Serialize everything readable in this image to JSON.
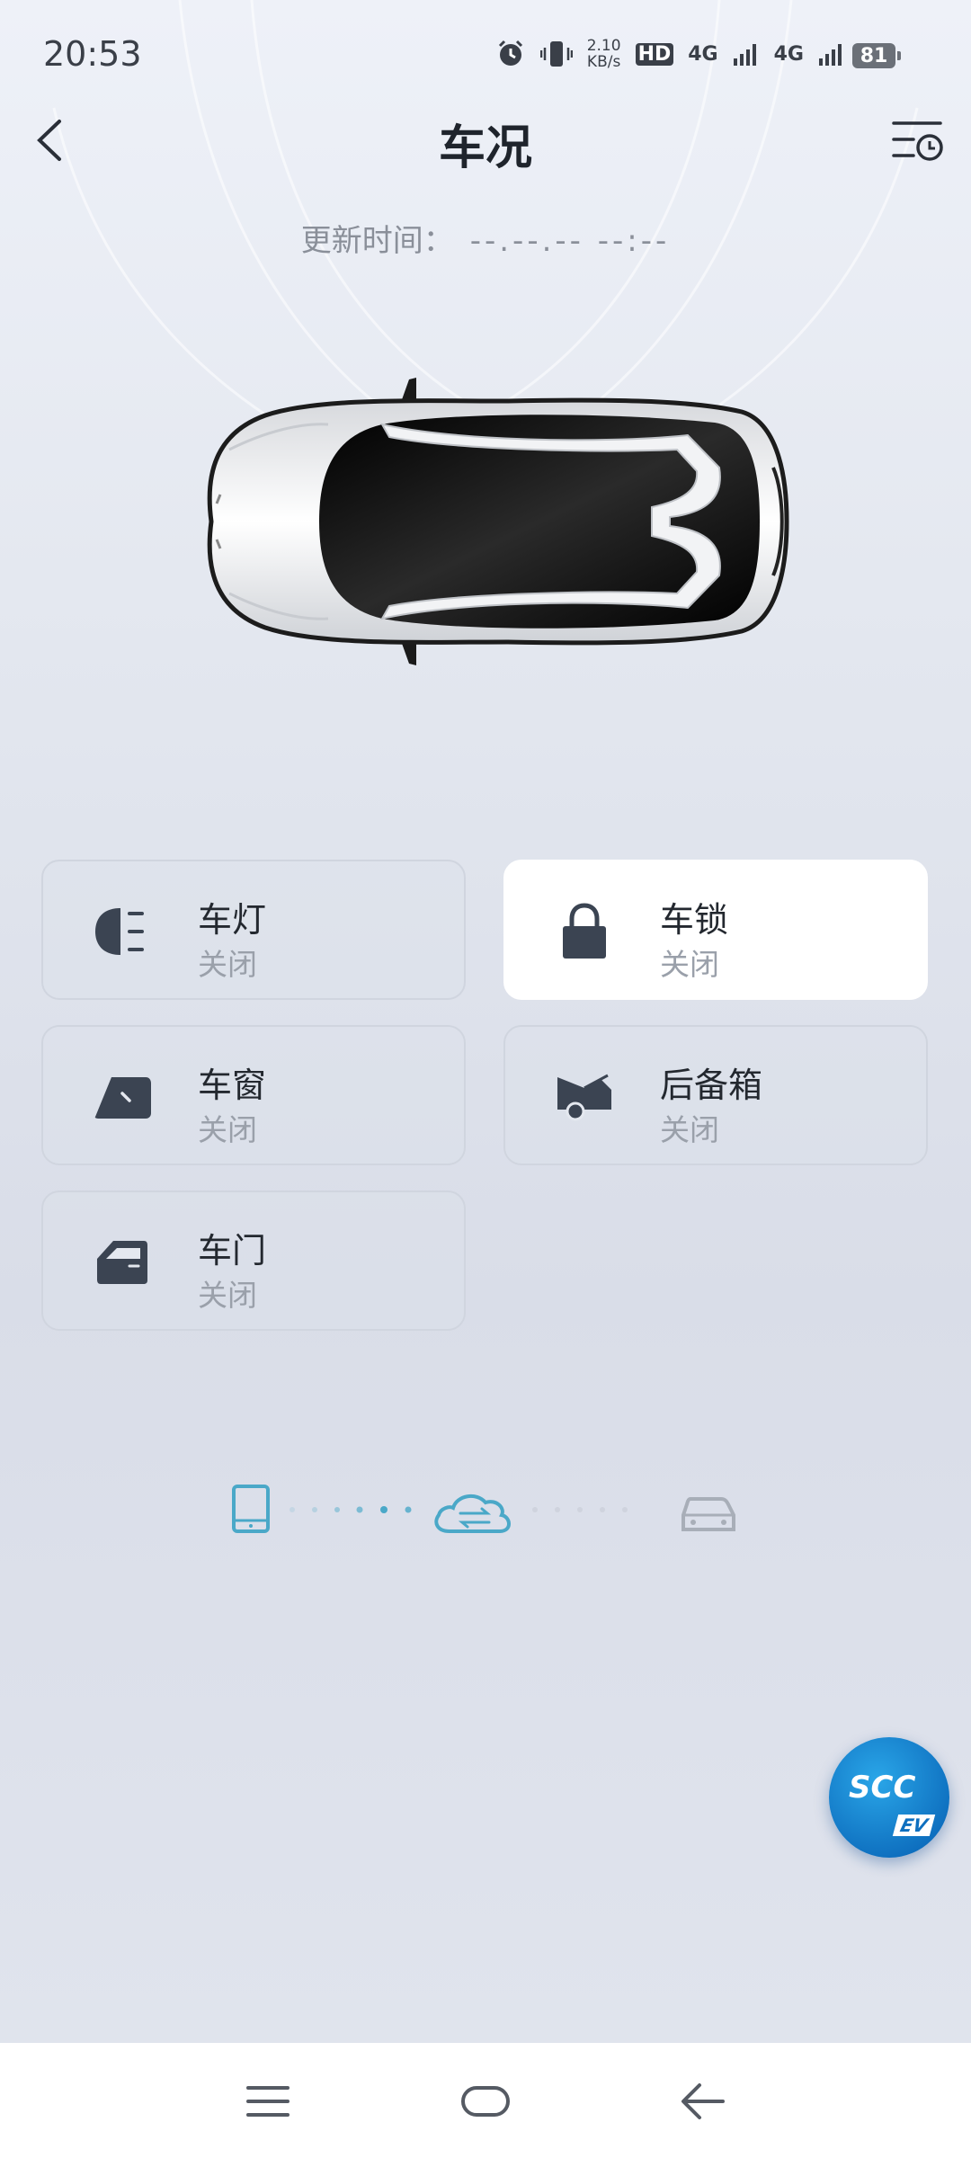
{
  "status_bar": {
    "time": "20:53",
    "speed_value": "2.10",
    "speed_unit": "KB/s",
    "hd_label": "HD",
    "network1": "4G",
    "network2": "4G",
    "battery": "81",
    "icons": [
      "alarm-icon",
      "vibrate-icon",
      "signal-icon",
      "signal-icon"
    ]
  },
  "header": {
    "title": "车况",
    "back_icon": "chevron-left-icon",
    "history_icon": "list-clock-icon"
  },
  "update": {
    "label": "更新时间：",
    "value": "--.--.-- --:--"
  },
  "tiles": [
    {
      "name": "车灯",
      "state": "关闭",
      "icon": "headlight-icon",
      "active": false
    },
    {
      "name": "车锁",
      "state": "关闭",
      "icon": "lock-icon",
      "active": true
    },
    {
      "name": "车窗",
      "state": "关闭",
      "icon": "window-icon",
      "active": false
    },
    {
      "name": "后备箱",
      "state": "关闭",
      "icon": "trunk-icon",
      "active": false
    },
    {
      "name": "车门",
      "state": "关闭",
      "icon": "door-icon",
      "active": false
    }
  ],
  "connection": {
    "icons": [
      "phone-icon",
      "cloud-sync-icon",
      "car-icon"
    ],
    "accent_color": "#4aa8c8",
    "inactive_color": "#a8aeb8"
  },
  "fab": {
    "label": "SCC",
    "badge": "EV"
  },
  "nav_bar": {
    "icons": [
      "menu-icon",
      "home-icon",
      "back-arrow-icon"
    ]
  }
}
